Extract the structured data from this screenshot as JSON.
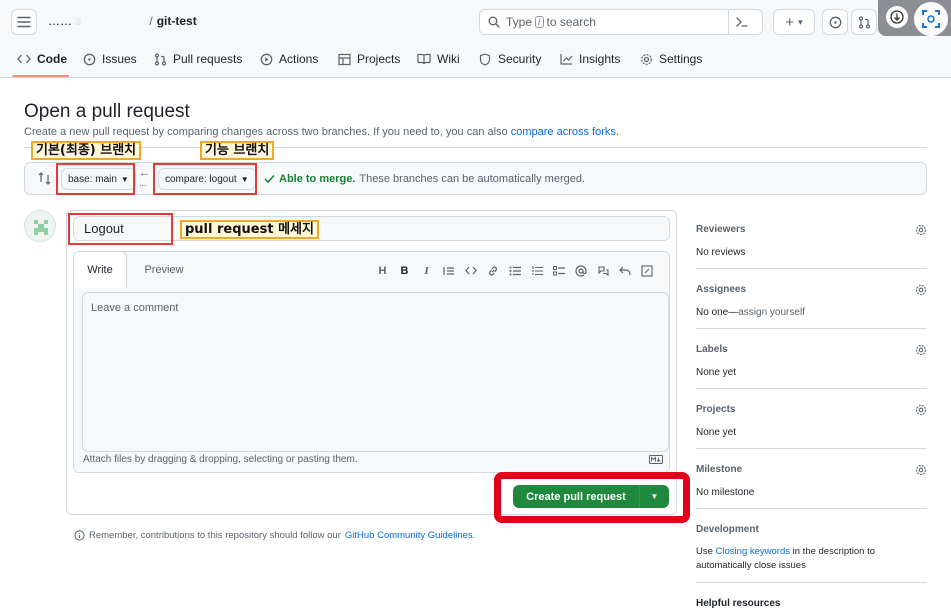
{
  "header": {
    "owner": "…… ",
    "owner_suffix": "s",
    "separator": "/",
    "repo": "git-test",
    "search_prefix": "Type",
    "search_key": "/",
    "search_suffix": "to search",
    "plus_label": "+",
    "plus_caret": "▾"
  },
  "tabs": [
    {
      "label": "Code",
      "icon": "code-icon"
    },
    {
      "label": "Issues",
      "icon": "issue-icon"
    },
    {
      "label": "Pull requests",
      "icon": "pull-request-icon"
    },
    {
      "label": "Actions",
      "icon": "play-icon"
    },
    {
      "label": "Projects",
      "icon": "table-icon"
    },
    {
      "label": "Wiki",
      "icon": "book-icon"
    },
    {
      "label": "Security",
      "icon": "shield-icon"
    },
    {
      "label": "Insights",
      "icon": "graph-icon"
    },
    {
      "label": "Settings",
      "icon": "gear-icon"
    }
  ],
  "page": {
    "title": "Open a pull request",
    "subtitle_text": "Create a new pull request by comparing changes across two branches. If you need to, you can also",
    "subtitle_link": "compare across forks",
    "subtitle_end": "."
  },
  "compare": {
    "base_label": "base: main",
    "compare_label": "compare: logout",
    "merge_status": "Able to merge.",
    "merge_message": "These branches can be automatically merged.",
    "arrow": "←",
    "dots": "..."
  },
  "annotations": {
    "base_branch": "기본(최종) 브랜치",
    "feature_branch": "기능 브랜치",
    "pr_message": "pull request 메세지"
  },
  "form": {
    "title_value": "Logout",
    "tab_write": "Write",
    "tab_preview": "Preview",
    "comment_placeholder": "Leave a comment",
    "attach_text": "Attach files by dragging & dropping, selecting or pasting them.",
    "create_label": "Create pull request",
    "toolbar": [
      "H",
      "B",
      "I"
    ]
  },
  "footer_note": {
    "text": "Remember, contributions to this repository should follow our",
    "link": "GitHub Community Guidelines",
    "end": "."
  },
  "sidebar": {
    "sections": [
      {
        "label": "Reviewers",
        "value": "No reviews"
      },
      {
        "label": "Assignees",
        "value_prefix": "No one—",
        "value_muted": "assign yourself"
      },
      {
        "label": "Labels",
        "value": "None yet"
      },
      {
        "label": "Projects",
        "value": "None yet"
      },
      {
        "label": "Milestone",
        "value": "No milestone"
      }
    ],
    "development": {
      "label": "Development",
      "text_prefix": "Use",
      "link": "Closing keywords",
      "text_suffix": "in the description to automatically close issues"
    },
    "helpful": "Helpful resources"
  },
  "colors": {
    "accent": "#0969da",
    "primary_button": "#1f883d",
    "merge_ok": "#1a7f37",
    "annotation_red": "#e53935",
    "annotation_orange": "#f4a52a"
  }
}
